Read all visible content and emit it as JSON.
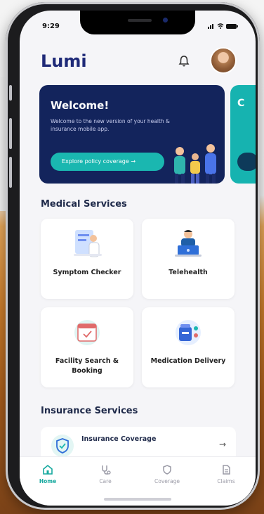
{
  "status": {
    "time": "9:29",
    "icons": "••il ≋ ▬"
  },
  "app": {
    "name": "Lumi"
  },
  "banner": {
    "title": "Welcome!",
    "text": "Welcome to the new version of your health & insurance mobile app.",
    "cta": "Explore policy coverage →",
    "next_initial": "C"
  },
  "sections": {
    "medical": "Medical Services",
    "insurance": "Insurance Services"
  },
  "medical_cards": [
    {
      "label": "Symptom Checker",
      "icon": "clipboard-doctor-icon"
    },
    {
      "label": "Telehealth",
      "icon": "laptop-doctor-icon"
    },
    {
      "label": "Facility Search & Booking",
      "icon": "calendar-icon"
    },
    {
      "label": "Medication Delivery",
      "icon": "medicine-box-icon"
    }
  ],
  "insurance_card": {
    "title": "Insurance Coverage",
    "arrow": "→"
  },
  "tabs": [
    {
      "label": "Home",
      "active": true
    },
    {
      "label": "Care",
      "active": false
    },
    {
      "label": "Coverage",
      "active": false
    },
    {
      "label": "Claims",
      "active": false
    }
  ],
  "colors": {
    "brand": "#1f2a78",
    "banner_bg": "#13245c",
    "accent": "#1ab7b0"
  }
}
